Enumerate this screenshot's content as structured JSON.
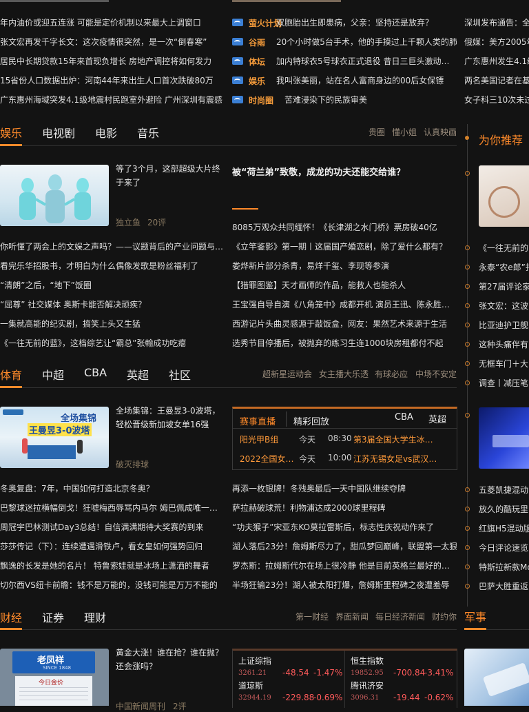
{
  "top": {
    "left_news": [
      "年内油价或迎五连涨 可能是定价机制以来最大上调窗口",
      "张文宏再发千字长文：这次疫情很突然，是一次“倒春寒”",
      "居民中长期贷款15年来首现负增长 房地产调控将如何发力",
      "15省份人口数据出炉：河南44年来出生人口首次跌破80万",
      "广东惠州海域突发4.1级地震村民跑室外避险 广州深圳有震感"
    ],
    "mid_news": [
      {
        "cat": "萤火计划",
        "text": "双胞胎出生即患病，父亲：坚持还是放弃？"
      },
      {
        "cat": "谷雨",
        "text": "20个小时做5台手术，他的手摸过上千颗人类的肺"
      },
      {
        "cat": "体坛",
        "text": "加内特球衣5号球衣正式退役 昔日三巨头激动…"
      },
      {
        "cat": "娱乐",
        "text": "我叫张美丽，站在名人富商身边的00后女保镖"
      },
      {
        "cat": "时尚圈",
        "text": "苦难浸染下的民族审美"
      }
    ],
    "right_news": [
      "深圳发布通告：全",
      "俄媒：美方2005年",
      "广东惠州发生4.1级",
      "两名美国记者在基",
      "女子科三10次未过"
    ]
  },
  "ent": {
    "tabs": [
      "娱乐",
      "电视剧",
      "电影",
      "音乐"
    ],
    "links": [
      "贵圈",
      "懂小姐",
      "认真映画"
    ],
    "feature_title": "等了3个月，这部超级大片终于来了",
    "feature_source": "独立鱼",
    "feature_comments": "20评",
    "headline": "被“荷兰弟”致敬，成龙的功夫还能交给谁？",
    "left_list": [
      "你听懂了两会上的文娱之声吗？——议题背后的产业问题与…",
      "看完乐华招股书，才明白为什么偶像发歌是粉丝福利了",
      "“清朗”之后，“地下”饭圈",
      "“屈尊” 社交媒体 奥斯卡能否解决顽疾？",
      "一集就高能的纪实剧，搞笑上头又生猛",
      "《一往无前的蓝》，这档综艺让“霸总”张翰成功吃瘪"
    ],
    "right_list": [
      "8085万观众共同缅怀！《长津湖之水门桥》票房破40亿",
      "《立竿鉴影》第一期丨这届国产婚恋剧，除了爱什么都有？",
      "娄烨新片部分杀青，易烊千玺、李现等参演",
      "【猎罪图鉴】天才画师的作品，能救人也能杀人",
      "王宝强自导自演《八角笼中》成都开机 演员王迅、陈永胜…",
      "西游记片头曲灵感源于敲饭盒，网友：果然艺术来源于生活",
      "选秀节目停播后，被抛弃的练习生连1000块房租都付不起"
    ]
  },
  "sport": {
    "tabs": [
      "体育",
      "中超",
      "CBA",
      "英超",
      "社区"
    ],
    "links": [
      "超新星运动会",
      "女主播大乐透",
      "有球必应",
      "中场不安定"
    ],
    "feature_title": "全场集锦：王曼昱3-0波塔，轻松晋级新加坡女单16强",
    "feature_source": "破灭排球",
    "img_caption_line1": "全场集锦",
    "img_caption_line2": "王曼昱3-0波塔",
    "live": {
      "tabs": [
        "赛事直播",
        "精彩回放"
      ],
      "extra_tabs": [
        "CBA",
        "英超"
      ],
      "rows": [
        {
          "name": "阳光甲B组",
          "day": "今天",
          "time": "08:30",
          "match": "第3届全国大学生冰…"
        },
        {
          "name": "2022全国女…",
          "day": "今天",
          "time": "10:00",
          "match": "江苏无锡女足vs武汉…"
        }
      ]
    },
    "left_list": [
      "冬奥复盘：7年，中国如何打造北京冬奥？",
      "巴黎球迷拉横幅倒戈！狂嘘梅西辱骂内马尔 姆巴佩成唯一…",
      "周冠宇巴林测试Day3总结！自信满满期待大奖赛的到来",
      "莎莎传记（下）：连续遭遇滑铁卢，看女皇如何强势回归",
      "飘逸的长发是她的名片！ 特鲁索娃就是冰场上潇洒的舞者",
      "切尔西VS纽卡前瞻：钱不是万能的，没钱可能是万万不能的"
    ],
    "right_list": [
      "再添一枚银牌！冬残奥最后一天中国队继续夺牌",
      "萨拉赫破球荒！利物浦达成2000球里程碑",
      "“功夫猴子”宋亚东KO莫拉雷斯后，标志性庆祝动作来了",
      "湖人落后23分！詹姆斯尽力了，甜瓜梦回巅峰，联盟第一太狠",
      "罗杰斯：拉姆斯代尔在场上很冷静 他是目前英格兰最好的…",
      "半场狂输23分！湖人被太阳打爆，詹姆斯里程碑之夜遭羞辱"
    ]
  },
  "finance": {
    "tabs": [
      "财经",
      "证券",
      "理财"
    ],
    "links": [
      "第一财经",
      "界面新闻",
      "每日经济新闻",
      "财约你"
    ],
    "feature_title": "黄金大涨！谁在抢？谁在抛？还会涨吗？",
    "feature_source": "中国新闻周刊",
    "feature_comments": "2评",
    "shop_sign": "老凤祥",
    "shop_sign_en": "SINCE 1848",
    "shop_sign2": "今日金价",
    "stocks": [
      {
        "name": "上证综指",
        "value": "3261.21",
        "change": "-48.54",
        "pct": "-1.47%"
      },
      {
        "name": "恒生指数",
        "value": "19852.95",
        "change": "-700.84",
        "pct": "-3.41%"
      },
      {
        "name": "道琼斯",
        "value": "32944.19",
        "change": "-229.88",
        "pct": "-0.69%"
      },
      {
        "name": "腾讯济安",
        "value": "3096.31",
        "change": "-19.44",
        "pct": "-0.62%"
      }
    ]
  },
  "side": {
    "recommend_title": "为你推荐",
    "list1": [
      "《一往无前的",
      "永泰“农e郎”打",
      "第27届评论家",
      "张文宏：这波",
      "比亚迪护卫舰",
      "这种头痛伴有",
      "无框车门＋大",
      "调查丨减压笔"
    ],
    "list2": [
      "五菱凯捷混动",
      "放久的酷玩里",
      "红旗H5混动版",
      "今日评论速览",
      "特斯拉新款Mo",
      "巴萨大胜重返"
    ],
    "military_title": "军事"
  },
  "colors": {
    "accent": "#ff8a2a",
    "background": "#131313",
    "down": "#ff5a5a"
  }
}
